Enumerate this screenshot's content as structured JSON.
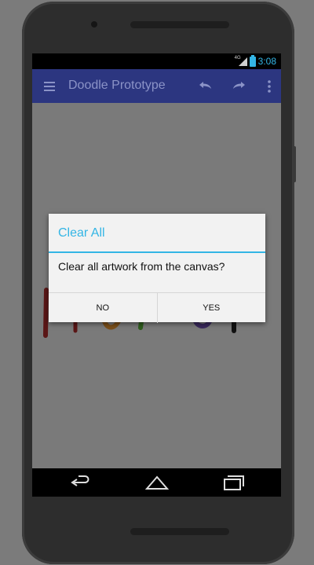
{
  "status_bar": {
    "network_type": "4G",
    "time": "3:08",
    "accent_color": "#33b5e5"
  },
  "app_bar": {
    "title": "Doodle Prototype",
    "background_color": "#2c3680",
    "icons": [
      "menu-icon",
      "undo-icon",
      "redo-icon",
      "overflow-menu-icon"
    ]
  },
  "dialog": {
    "title": "Clear All",
    "message": "Clear all artwork from the canvas?",
    "negative_button": "NO",
    "positive_button": "YES",
    "title_color": "#33b5e5"
  },
  "nav_bar": {
    "icons": [
      "back-icon",
      "home-icon",
      "recent-apps-icon"
    ]
  }
}
